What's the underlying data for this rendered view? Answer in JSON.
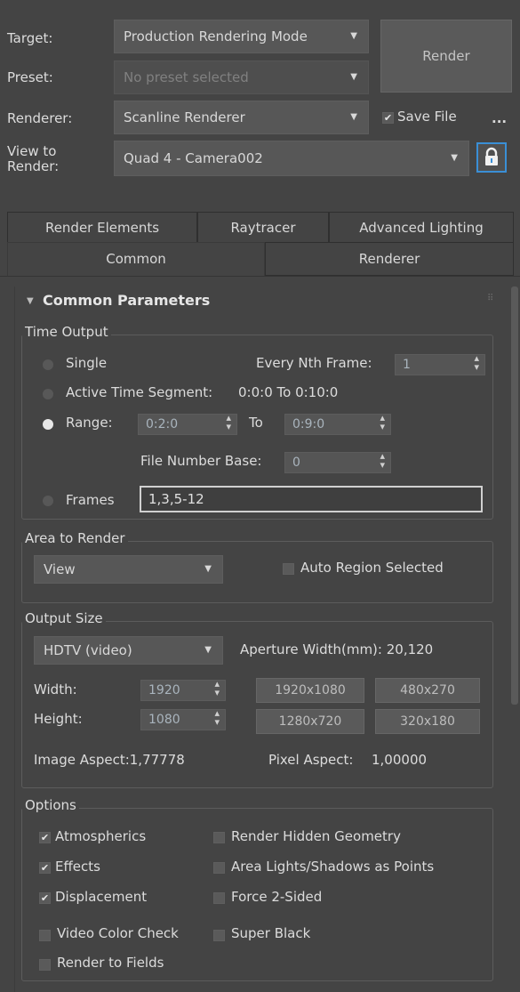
{
  "header": {
    "target_label": "Target:",
    "target_value": "Production Rendering Mode",
    "preset_label": "Preset:",
    "preset_placeholder": "No preset selected",
    "renderer_label": "Renderer:",
    "renderer_value": "Scanline Renderer",
    "save_file_label": "Save File",
    "more_label": "...",
    "render_button": "Render",
    "view_label_line1": "View to",
    "view_label_line2": "Render:",
    "view_value": "Quad 4 - Camera002"
  },
  "tabs": {
    "row1": [
      "Render Elements",
      "Raytracer",
      "Advanced Lighting"
    ],
    "row2": [
      "Common",
      "Renderer"
    ]
  },
  "rollout": {
    "title": "Common Parameters"
  },
  "time_output": {
    "title": "Time Output",
    "single": "Single",
    "every_nth_label": "Every Nth Frame:",
    "every_nth_value": "1",
    "active_segment_label": "Active Time Segment:",
    "active_segment_value": "0:0:0 To 0:10:0",
    "range_label": "Range:",
    "range_from": "0:2:0",
    "range_to_label": "To",
    "range_to": "0:9:0",
    "file_number_base_label": "File Number Base:",
    "file_number_base_value": "0",
    "frames_label": "Frames",
    "frames_value": "1,3,5-12"
  },
  "area_to_render": {
    "title": "Area to Render",
    "value": "View",
    "auto_region_label": "Auto Region Selected"
  },
  "output_size": {
    "title": "Output Size",
    "preset_value": "HDTV (video)",
    "aperture_label": "Aperture Width(mm): 20,120",
    "width_label": "Width:",
    "width_value": "1920",
    "height_label": "Height:",
    "height_value": "1080",
    "presets": [
      "1920x1080",
      "480x270",
      "1280x720",
      "320x180"
    ],
    "image_aspect": "Image Aspect:1,77778",
    "pixel_aspect_label": "Pixel Aspect:",
    "pixel_aspect_value": "1,00000"
  },
  "options": {
    "title": "Options",
    "atmospherics": "Atmospherics",
    "effects": "Effects",
    "displacement": "Displacement",
    "video_color_check": "Video Color Check",
    "render_to_fields": "Render to Fields",
    "render_hidden": "Render Hidden Geometry",
    "area_lights": "Area Lights/Shadows as Points",
    "force_2sided": "Force 2-Sided",
    "super_black": "Super Black"
  },
  "colors": {
    "background": "#444444",
    "field": "#575757",
    "lock_blue": "#3a8fd6"
  },
  "icons": {
    "check": "check-icon",
    "lock": "lock-icon",
    "dropdown": "chevron-down-icon"
  }
}
